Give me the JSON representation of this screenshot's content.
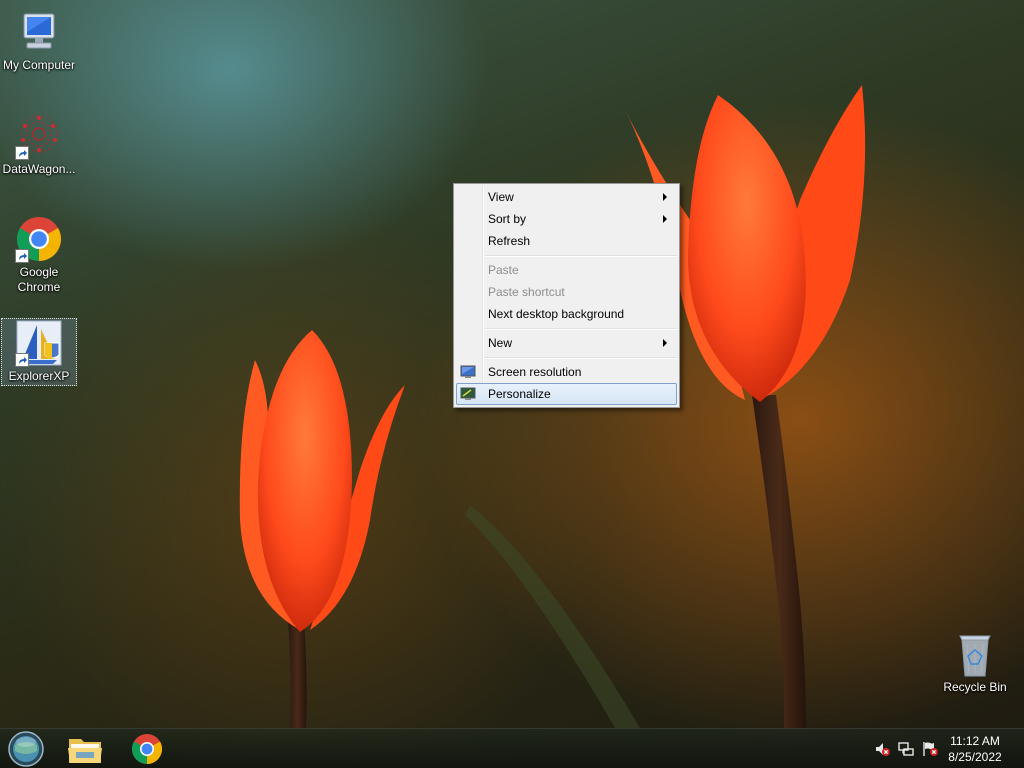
{
  "desktop": {
    "icons": [
      {
        "label": "My Computer",
        "icon": "computer-icon"
      },
      {
        "label": "DataWagon...",
        "icon": "datawagon-icon"
      },
      {
        "label": "Google\nChrome",
        "icon": "chrome-icon"
      },
      {
        "label": "ExplorerXP",
        "icon": "explorerxp-icon"
      },
      {
        "label": "Recycle Bin",
        "icon": "recycle-bin-icon"
      }
    ]
  },
  "context_menu": {
    "items": [
      {
        "label": "View",
        "submenu": true
      },
      {
        "label": "Sort by",
        "submenu": true
      },
      {
        "label": "Refresh"
      },
      {
        "label": "Paste",
        "disabled": true
      },
      {
        "label": "Paste shortcut",
        "disabled": true
      },
      {
        "label": "Next desktop background"
      },
      {
        "label": "New",
        "submenu": true
      },
      {
        "label": "Screen resolution",
        "icon": "screen-resolution-icon"
      },
      {
        "label": "Personalize",
        "icon": "personalize-icon",
        "highlighted": true
      }
    ]
  },
  "taskbar": {
    "start_icon": "start-orb-icon",
    "apps": [
      {
        "name": "file-explorer",
        "icon": "folder-icon"
      },
      {
        "name": "google-chrome",
        "icon": "chrome-icon"
      }
    ],
    "tray": [
      {
        "icon": "volume-muted-icon"
      },
      {
        "icon": "network-icon"
      },
      {
        "icon": "action-center-flag-icon"
      }
    ],
    "clock": {
      "time": "11:12 AM",
      "date": "8/25/2022"
    }
  },
  "colors": {
    "tulip": "#ff4a1c",
    "menu_bg": "#f0f0f0",
    "menu_highlight_border": "#7da2ce"
  }
}
